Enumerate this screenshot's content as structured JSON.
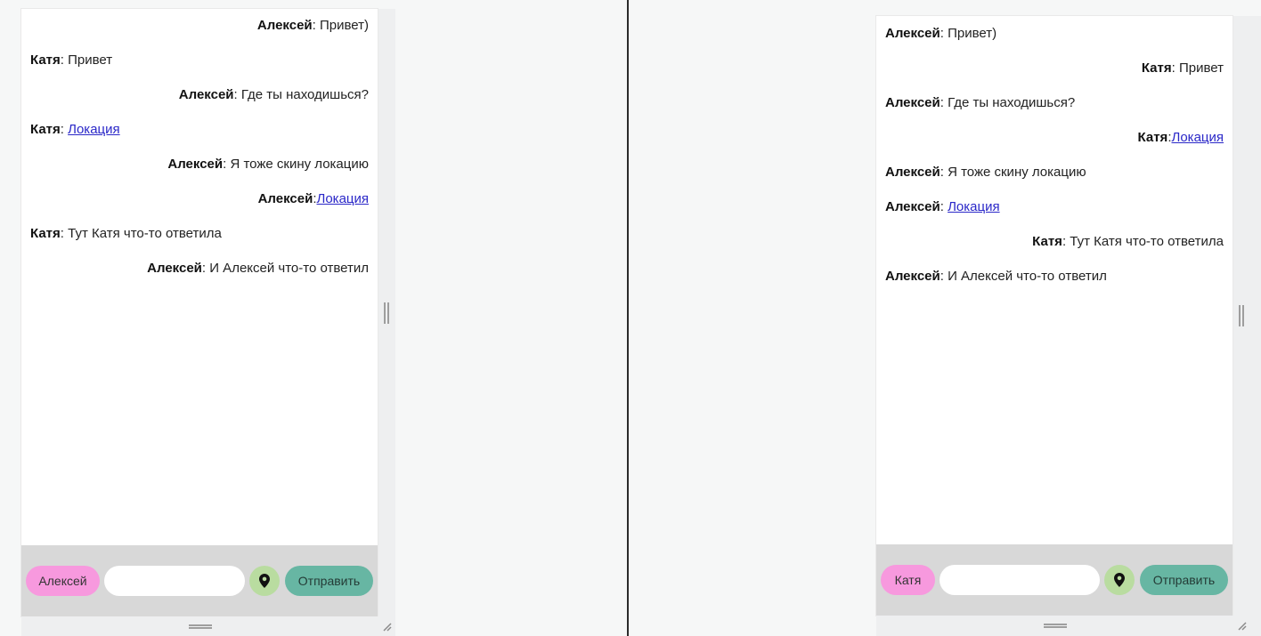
{
  "left_chat": {
    "messages": [
      {
        "align": "right",
        "author": "Алексей",
        "sep": ": ",
        "text": "Привет)",
        "link": ""
      },
      {
        "align": "left",
        "author": "Катя",
        "sep": ": ",
        "text": "Привет",
        "link": ""
      },
      {
        "align": "right",
        "author": "Алексей",
        "sep": ": ",
        "text": "Где ты находишься?",
        "link": ""
      },
      {
        "align": "left",
        "author": "Катя",
        "sep": ": ",
        "text": "",
        "link": "Локация"
      },
      {
        "align": "right",
        "author": "Алексей",
        "sep": ": ",
        "text": "Я тоже скину локацию",
        "link": ""
      },
      {
        "align": "right",
        "author": "Алексей",
        "sep": ":",
        "text": "",
        "link": "Локация"
      },
      {
        "align": "left",
        "author": "Катя",
        "sep": ": ",
        "text": "Тут Катя что-то ответила",
        "link": ""
      },
      {
        "align": "right",
        "author": "Алексей",
        "sep": ": ",
        "text": "И Алексей что-то ответил",
        "link": ""
      }
    ],
    "user_button": "Алексей",
    "input_value": "",
    "send_button": "Отправить"
  },
  "right_chat": {
    "messages": [
      {
        "align": "left",
        "author": "Алексей",
        "sep": ": ",
        "text": "Привет)",
        "link": ""
      },
      {
        "align": "right",
        "author": "Катя",
        "sep": ": ",
        "text": "Привет",
        "link": ""
      },
      {
        "align": "left",
        "author": "Алексей",
        "sep": ": ",
        "text": "Где ты находишься?",
        "link": ""
      },
      {
        "align": "right",
        "author": "Катя",
        "sep": ":",
        "text": "",
        "link": "Локация"
      },
      {
        "align": "left",
        "author": "Алексей",
        "sep": ": ",
        "text": "Я тоже скину локацию",
        "link": ""
      },
      {
        "align": "left",
        "author": "Алексей",
        "sep": ": ",
        "text": "",
        "link": "Локация"
      },
      {
        "align": "right",
        "author": "Катя",
        "sep": ": ",
        "text": "Тут Катя что-то ответила",
        "link": ""
      },
      {
        "align": "left",
        "author": "Алексей",
        "sep": ": ",
        "text": "И Алексей что-то ответил",
        "link": ""
      }
    ],
    "user_button": "Катя",
    "input_value": "",
    "send_button": "Отправить"
  },
  "icons": {
    "location": "location-pin-icon",
    "resize_vertical": "vertical-resize-grip-icon",
    "resize_horizontal": "horizontal-resize-grip-icon",
    "resize_corner": "corner-resize-icon"
  },
  "colors": {
    "user_button": "#f799de",
    "location_button": "#b9dca0",
    "send_button": "#67b6a3",
    "toolbar": "#d8d8d8",
    "link": "#2a27c8"
  }
}
